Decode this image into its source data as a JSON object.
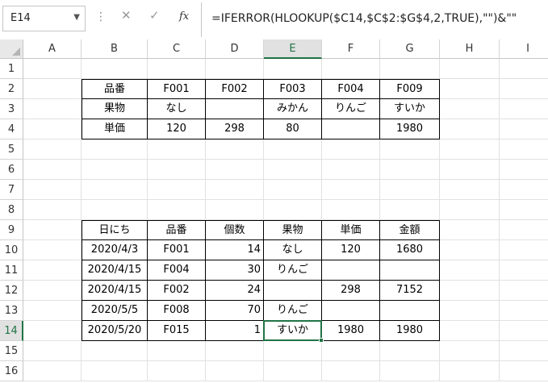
{
  "formula_bar": {
    "name_box": "E14",
    "formula": "=IFERROR(HLOOKUP($C14,$C$2:$G$4,2,TRUE),\"\")&\"\""
  },
  "icons": {
    "namebox_dropdown": "chevron-down-icon",
    "more": "vertical-dots-icon",
    "cancel": "cancel-x-icon",
    "enter": "checkmark-icon",
    "insert_function": "fx-icon"
  },
  "columns": [
    "A",
    "B",
    "C",
    "D",
    "E",
    "F",
    "G",
    "H",
    "I"
  ],
  "rows": [
    "1",
    "2",
    "3",
    "4",
    "5",
    "6",
    "7",
    "8",
    "9",
    "10",
    "11",
    "12",
    "13",
    "14",
    "15",
    "16"
  ],
  "selected": {
    "column": "E",
    "row": "14"
  },
  "accent_color": "#217346",
  "cells": {
    "B2": "品番",
    "C2": "F001",
    "D2": "F002",
    "E2": "F003",
    "F2": "F004",
    "G2": "F009",
    "B3": "果物",
    "C3": "なし",
    "D3": "",
    "E3": "みかん",
    "F3": "りんご",
    "G3": "すいか",
    "B4": "単価",
    "C4": "120",
    "D4": "298",
    "E4": "80",
    "F4": "",
    "G4": "1980",
    "B9": "日にち",
    "C9": "品番",
    "D9": "個数",
    "E9": "果物",
    "F9": "単価",
    "G9": "金額",
    "B10": "2020/4/3",
    "C10": "F001",
    "D10": "14",
    "E10": "なし",
    "F10": "120",
    "G10": "1680",
    "B11": "2020/4/15",
    "C11": "F004",
    "D11": "30",
    "E11": "りんご",
    "F11": "",
    "G11": "",
    "B12": "2020/4/15",
    "C12": "F002",
    "D12": "24",
    "E12": "",
    "F12": "298",
    "G12": "7152",
    "B13": "2020/5/5",
    "C13": "F008",
    "D13": "70",
    "E13": "りんご",
    "F13": "",
    "G13": "",
    "B14": "2020/5/20",
    "C14": "F015",
    "D14": "1",
    "E14": "すいか",
    "F14": "1980",
    "G14": "1980"
  }
}
